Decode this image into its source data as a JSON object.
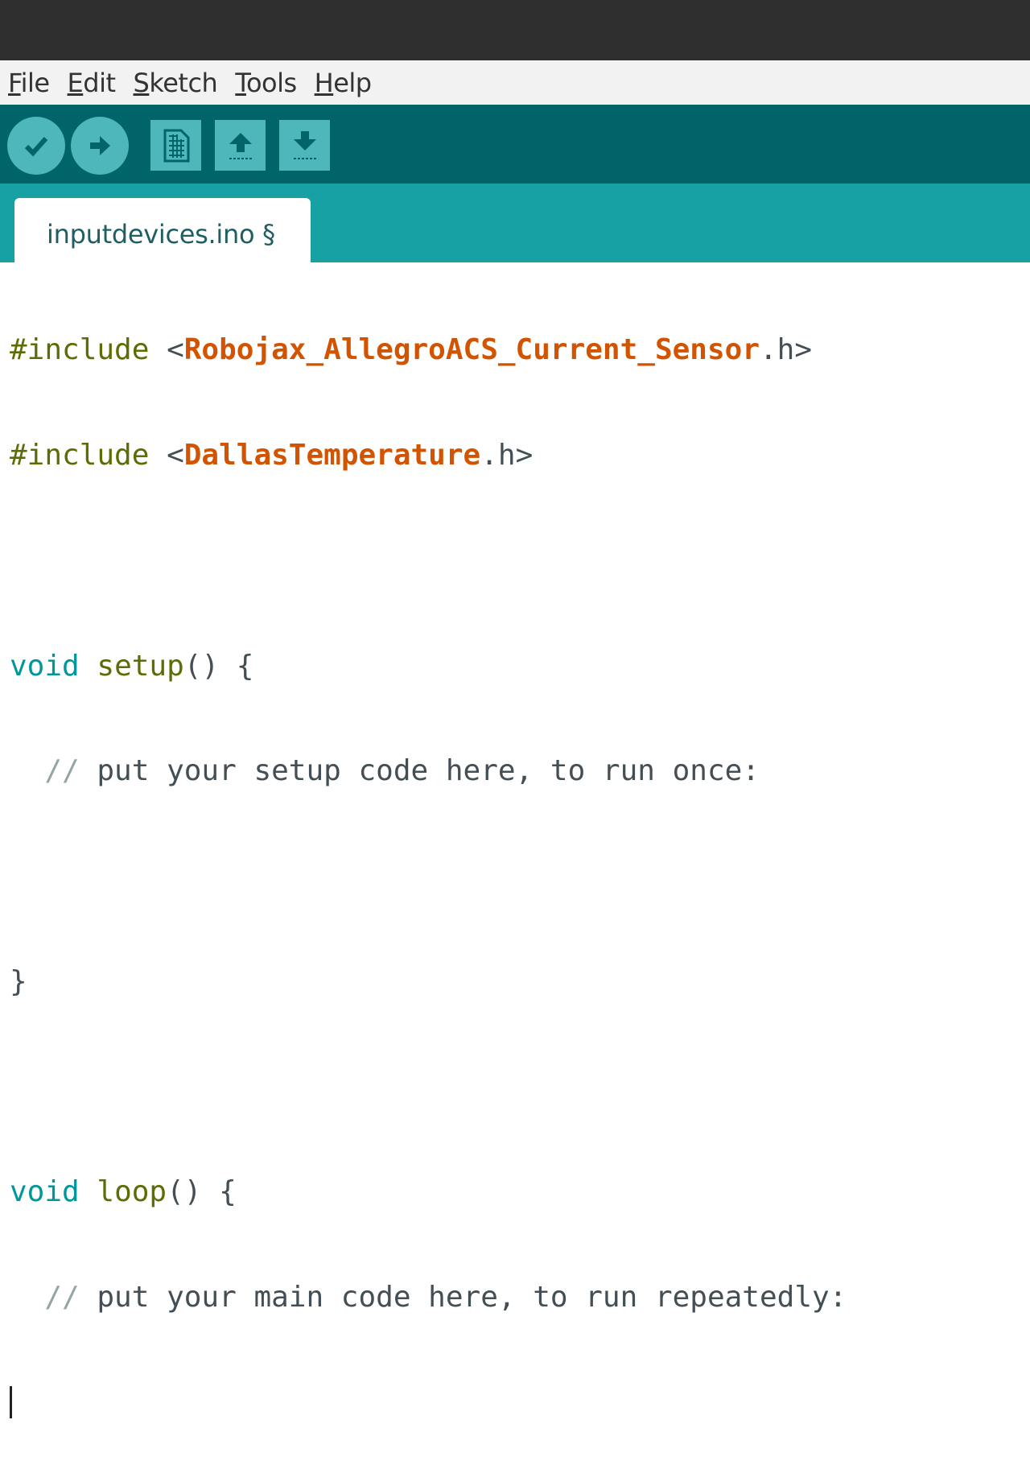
{
  "window": {
    "title": ""
  },
  "menu": [
    {
      "label": "File",
      "mnemonic": "F",
      "rest": "ile"
    },
    {
      "label": "Edit",
      "mnemonic": "E",
      "rest": "dit"
    },
    {
      "label": "Sketch",
      "mnemonic": "S",
      "rest": "ketch"
    },
    {
      "label": "Tools",
      "mnemonic": "T",
      "rest": "ools"
    },
    {
      "label": "Help",
      "mnemonic": "H",
      "rest": "elp"
    }
  ],
  "toolbar": {
    "buttons": [
      {
        "name": "verify",
        "icon": "check-icon"
      },
      {
        "name": "upload",
        "icon": "arrow-right-icon"
      },
      {
        "name": "new",
        "icon": "new-file-icon"
      },
      {
        "name": "open",
        "icon": "arrow-up-icon"
      },
      {
        "name": "save",
        "icon": "arrow-down-icon"
      }
    ]
  },
  "tab": {
    "label": "inputdevices.ino §"
  },
  "code": {
    "l1": {
      "pre": "#include",
      "open": " <",
      "lib": "Robojax_AllegroACS_Current_Sensor",
      "close": ".h>"
    },
    "l2": {
      "pre": "#include",
      "open": " <",
      "lib": "DallasTemperature",
      "close": ".h>"
    },
    "l4": {
      "type": "void",
      "fn": "setup",
      "rest": "() {"
    },
    "l5": {
      "slashes": "  //",
      "text": " put your setup code here, to run once:"
    },
    "l7": "}",
    "l9": {
      "type": "void",
      "fn": "loop",
      "rest": "() {"
    },
    "l10": {
      "slashes": "  //",
      "text": " put your main code here, to run repeatedly:"
    }
  },
  "colors": {
    "toolbar": "#006468",
    "tabbar": "#17a1a5",
    "button": "#4db7bb",
    "library": "#d35400",
    "keyword": "#00979c",
    "preprocessor": "#5e6d03"
  }
}
